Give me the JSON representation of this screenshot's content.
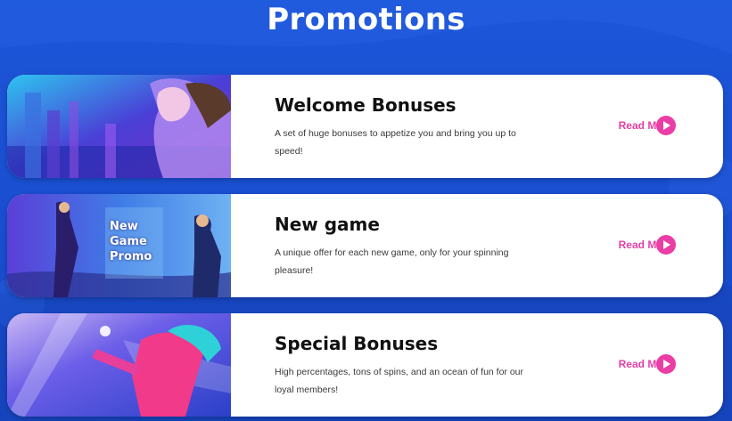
{
  "page": {
    "title": "Promotions"
  },
  "colors": {
    "accent": "#ea3da6",
    "background": "#1d56d9"
  },
  "promotions": [
    {
      "title": "Welcome Bonuses",
      "description": "A set of huge bonuses to appetize you and bring you up to speed!",
      "link_label": "Read More",
      "icon": "play-icon"
    },
    {
      "title": "New game",
      "description": "A unique offer for each new game, only for your spinning pleasure!",
      "link_label": "Read More",
      "icon": "play-icon",
      "image_text": [
        "New",
        "Game",
        "Promo"
      ]
    },
    {
      "title": "Special Bonuses",
      "description": "High percentages, tons of spins, and an ocean of fun for our loyal members!",
      "link_label": "Read More",
      "icon": "play-icon"
    }
  ]
}
